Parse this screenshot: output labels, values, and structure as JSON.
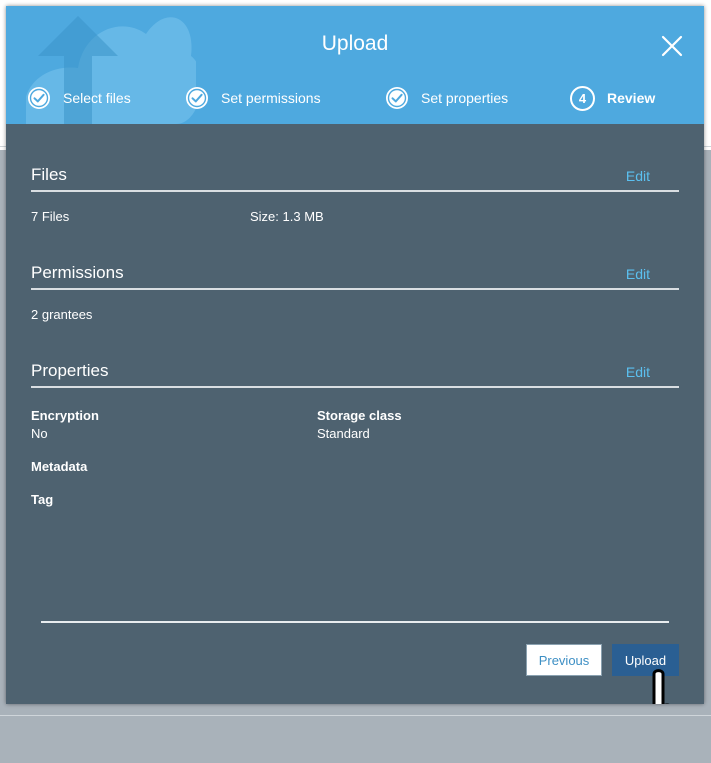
{
  "modal": {
    "title": "Upload"
  },
  "steps": [
    {
      "label": "Select files",
      "state": "done"
    },
    {
      "label": "Set permissions",
      "state": "done"
    },
    {
      "label": "Set properties",
      "state": "done"
    },
    {
      "number": "4",
      "label": "Review",
      "state": "active"
    }
  ],
  "sections": {
    "files": {
      "title": "Files",
      "edit_label": "Edit",
      "count": "7 Files",
      "size": "Size: 1.3 MB"
    },
    "permissions": {
      "title": "Permissions",
      "edit_label": "Edit",
      "grantees": "2 grantees"
    },
    "properties": {
      "title": "Properties",
      "edit_label": "Edit",
      "encryption_label": "Encryption",
      "encryption_value": "No",
      "storage_class_label": "Storage class",
      "storage_class_value": "Standard",
      "metadata_label": "Metadata",
      "tag_label": "Tag"
    }
  },
  "footer": {
    "previous_label": "Previous",
    "upload_label": "Upload"
  },
  "colors": {
    "header": "#4ea9df",
    "body": "#4e6270",
    "link": "#5bc0f0",
    "primary_button": "#2a5f93"
  },
  "icons": {
    "watermark": "upload-cloud-icon",
    "close": "close-icon",
    "step_done": "check-circle-icon",
    "cursor": "hand-pointer-icon"
  }
}
